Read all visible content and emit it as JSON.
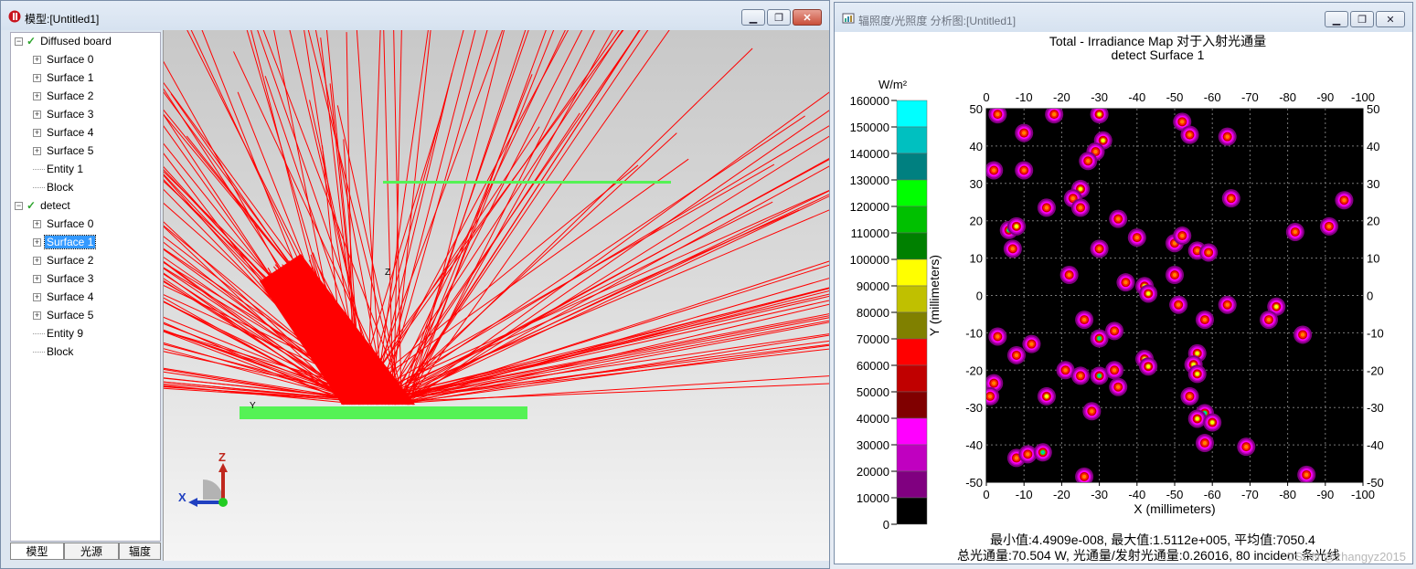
{
  "model_window": {
    "title": "模型:[Untitled1]",
    "tree": [
      {
        "label": "Diffused board",
        "level": 0,
        "expander": "−",
        "checked": true
      },
      {
        "label": "Surface 0",
        "level": 1,
        "expander": "+"
      },
      {
        "label": "Surface 1",
        "level": 1,
        "expander": "+"
      },
      {
        "label": "Surface 2",
        "level": 1,
        "expander": "+"
      },
      {
        "label": "Surface 3",
        "level": 1,
        "expander": "+"
      },
      {
        "label": "Surface 4",
        "level": 1,
        "expander": "+"
      },
      {
        "label": "Surface 5",
        "level": 1,
        "expander": "+"
      },
      {
        "label": "Entity 1",
        "level": 1,
        "expander": ""
      },
      {
        "label": "Block",
        "level": 1,
        "expander": ""
      },
      {
        "label": "detect",
        "level": 0,
        "expander": "−",
        "checked": true
      },
      {
        "label": "Surface 0",
        "level": 1,
        "expander": "+"
      },
      {
        "label": "Surface 1",
        "level": 1,
        "expander": "+",
        "selected": true
      },
      {
        "label": "Surface 2",
        "level": 1,
        "expander": "+"
      },
      {
        "label": "Surface 3",
        "level": 1,
        "expander": "+"
      },
      {
        "label": "Surface 4",
        "level": 1,
        "expander": "+"
      },
      {
        "label": "Surface 5",
        "level": 1,
        "expander": "+"
      },
      {
        "label": "Entity 9",
        "level": 1,
        "expander": ""
      },
      {
        "label": "Block",
        "level": 1,
        "expander": ""
      }
    ],
    "tabs": [
      "模型",
      "光源",
      "辐度"
    ],
    "axis_labels": {
      "z": "Z",
      "x": "X",
      "y_small": "Y",
      "z_small": "Z"
    },
    "colors": {
      "ray": "#ff0000",
      "board": "#55f255"
    }
  },
  "analysis_window": {
    "title": "辐照度/光照度 分析图:[Untitled1]",
    "title_line1": "Total - Irradiance Map 对于入射光通量",
    "title_line2": "detect Surface 1",
    "ylabel": "Y (millimeters)",
    "xlabel": "X (millimeters)",
    "stats_line1": "最小值:4.4909e-008, 最大值:1.5112e+005, 平均值:7050.4",
    "stats_line2": "总光通量:70.504 W, 光通量/发射光通量:0.26016, 80 incident 条光线",
    "watermark": "CSDN @zhangyz2015"
  },
  "chart_data": {
    "type": "heatmap",
    "title": "Total - Irradiance Map 对于入射光通量",
    "subtitle": "detect Surface 1",
    "xlabel": "X (millimeters)",
    "ylabel": "Y (millimeters)",
    "x_ticks": [
      "0",
      "-10",
      "-20",
      "-30",
      "-40",
      "-50",
      "-60",
      "-70",
      "-80",
      "-90",
      "-100"
    ],
    "y_ticks": [
      "50",
      "40",
      "30",
      "20",
      "10",
      "0",
      "-10",
      "-20",
      "-30",
      "-40",
      "-50"
    ],
    "xlim": [
      0,
      -100
    ],
    "ylim": [
      -50,
      50
    ],
    "grid": true,
    "colorbar": {
      "unit": "W/m²",
      "labels": [
        "160000",
        "150000",
        "140000",
        "130000",
        "120000",
        "110000",
        "100000",
        "90000",
        "80000",
        "70000",
        "60000",
        "50000",
        "40000",
        "30000",
        "20000",
        "10000",
        "0"
      ],
      "colors": [
        "#00ffff",
        "#00c0c0",
        "#008080",
        "#00ff00",
        "#00c000",
        "#008000",
        "#ffff00",
        "#c0c000",
        "#808000",
        "#ff0000",
        "#c00000",
        "#800000",
        "#ff00ff",
        "#c000c0",
        "#800080",
        "#000000"
      ]
    },
    "spots": [
      {
        "x": -3,
        "y": 48.5,
        "peak": "red"
      },
      {
        "x": -18,
        "y": 48.5,
        "peak": "red"
      },
      {
        "x": -30,
        "y": 48.5,
        "peak": "yellow"
      },
      {
        "x": -52,
        "y": 46.5,
        "peak": "red"
      },
      {
        "x": -10,
        "y": 43.5,
        "peak": "red"
      },
      {
        "x": -31,
        "y": 41.5,
        "peak": "yellow"
      },
      {
        "x": -54,
        "y": 43,
        "peak": "red"
      },
      {
        "x": -64,
        "y": 42.5,
        "peak": "red"
      },
      {
        "x": -29,
        "y": 38.5,
        "peak": "red"
      },
      {
        "x": -27,
        "y": 36,
        "peak": "red"
      },
      {
        "x": -2,
        "y": 33.5,
        "peak": "red"
      },
      {
        "x": -10,
        "y": 33.5,
        "peak": "red"
      },
      {
        "x": -25,
        "y": 28.5,
        "peak": "yellow"
      },
      {
        "x": -23,
        "y": 26,
        "peak": "red"
      },
      {
        "x": -25,
        "y": 23.5,
        "peak": "red"
      },
      {
        "x": -16,
        "y": 23.5,
        "peak": "red"
      },
      {
        "x": -65,
        "y": 26,
        "peak": "red"
      },
      {
        "x": -95,
        "y": 25.5,
        "peak": "red"
      },
      {
        "x": -35,
        "y": 20.5,
        "peak": "red"
      },
      {
        "x": -6,
        "y": 17.5,
        "peak": "cyan"
      },
      {
        "x": -8,
        "y": 18.5,
        "peak": "yellow"
      },
      {
        "x": -7,
        "y": 12.5,
        "peak": "red"
      },
      {
        "x": -40,
        "y": 15.5,
        "peak": "red"
      },
      {
        "x": -50,
        "y": 14,
        "peak": "red"
      },
      {
        "x": -52,
        "y": 16,
        "peak": "red"
      },
      {
        "x": -56,
        "y": 12,
        "peak": "red"
      },
      {
        "x": -59,
        "y": 11.5,
        "peak": "red"
      },
      {
        "x": -30,
        "y": 12.5,
        "peak": "red"
      },
      {
        "x": -82,
        "y": 17,
        "peak": "red"
      },
      {
        "x": -91,
        "y": 18.5,
        "peak": "red"
      },
      {
        "x": -22,
        "y": 5.5,
        "peak": "red"
      },
      {
        "x": -50,
        "y": 5.5,
        "peak": "red"
      },
      {
        "x": -37,
        "y": 3.5,
        "peak": "red"
      },
      {
        "x": -42,
        "y": 2.5,
        "peak": "yellow"
      },
      {
        "x": -43,
        "y": 0.5,
        "peak": "yellow"
      },
      {
        "x": -51,
        "y": -2.5,
        "peak": "red"
      },
      {
        "x": -64,
        "y": -2.5,
        "peak": "red"
      },
      {
        "x": -58,
        "y": -6.5,
        "peak": "red"
      },
      {
        "x": -77,
        "y": -3,
        "peak": "yellow"
      },
      {
        "x": -75,
        "y": -6.5,
        "peak": "red"
      },
      {
        "x": -26,
        "y": -6.5,
        "peak": "red"
      },
      {
        "x": -34,
        "y": -9.5,
        "peak": "red"
      },
      {
        "x": -30,
        "y": -11.5,
        "peak": "cyan"
      },
      {
        "x": -3,
        "y": -11,
        "peak": "red"
      },
      {
        "x": -12,
        "y": -13,
        "peak": "red"
      },
      {
        "x": -8,
        "y": -16,
        "peak": "red"
      },
      {
        "x": -84,
        "y": -10.5,
        "peak": "red"
      },
      {
        "x": -42,
        "y": -17,
        "peak": "yellow"
      },
      {
        "x": -43,
        "y": -19,
        "peak": "yellow"
      },
      {
        "x": -56,
        "y": -15.5,
        "peak": "yellow"
      },
      {
        "x": -55,
        "y": -18.5,
        "peak": "yellow"
      },
      {
        "x": -56,
        "y": -21,
        "peak": "yellow"
      },
      {
        "x": -21,
        "y": -20,
        "peak": "red"
      },
      {
        "x": -25,
        "y": -21.5,
        "peak": "red"
      },
      {
        "x": -30,
        "y": -21.5,
        "peak": "cyan"
      },
      {
        "x": -34,
        "y": -20,
        "peak": "red"
      },
      {
        "x": -35,
        "y": -24.5,
        "peak": "red"
      },
      {
        "x": -2,
        "y": -23.5,
        "peak": "red"
      },
      {
        "x": -1,
        "y": -27,
        "peak": "red"
      },
      {
        "x": -16,
        "y": -27,
        "peak": "yellow"
      },
      {
        "x": -54,
        "y": -27,
        "peak": "red"
      },
      {
        "x": -28,
        "y": -31,
        "peak": "red"
      },
      {
        "x": -58,
        "y": -31.5,
        "peak": "cyan"
      },
      {
        "x": -56,
        "y": -33,
        "peak": "yellow"
      },
      {
        "x": -60,
        "y": -34,
        "peak": "yellow"
      },
      {
        "x": -58,
        "y": -39.5,
        "peak": "red"
      },
      {
        "x": -69,
        "y": -40.5,
        "peak": "red"
      },
      {
        "x": -8,
        "y": -43.5,
        "peak": "red"
      },
      {
        "x": -11,
        "y": -42.5,
        "peak": "red"
      },
      {
        "x": -15,
        "y": -42,
        "peak": "cyan"
      },
      {
        "x": -26,
        "y": -48.5,
        "peak": "red"
      },
      {
        "x": -85,
        "y": -48,
        "peak": "red"
      }
    ]
  }
}
